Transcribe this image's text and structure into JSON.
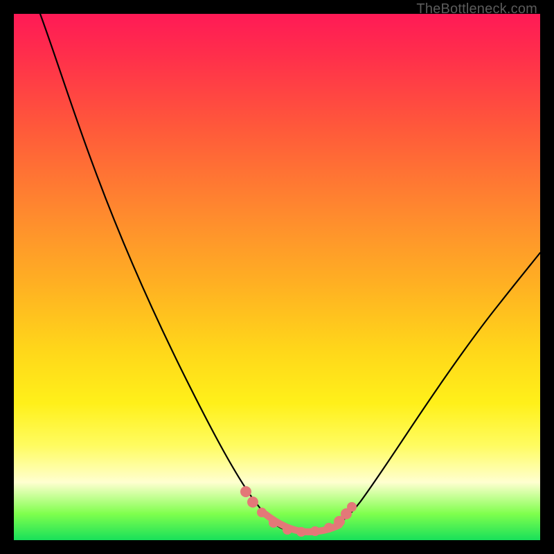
{
  "attribution": "TheBottleneck.com",
  "chart_data": {
    "type": "line",
    "title": "",
    "xlabel": "",
    "ylabel": "",
    "xlim": [
      0,
      100
    ],
    "ylim": [
      0,
      100
    ],
    "grid": false,
    "legend": false,
    "note": "V-shaped bottleneck curve over a red→yellow→green vertical gradient. Y values estimated from a 0–100 scale (0 at bottom = best / green, 100 at top = worst / red). Axes are unlabeled in the source image.",
    "series": [
      {
        "name": "bottleneck-curve",
        "x": [
          5,
          10,
          15,
          20,
          25,
          30,
          35,
          40,
          43,
          46,
          48,
          50,
          52,
          54,
          56,
          58,
          60,
          62,
          65,
          70,
          75,
          80,
          85,
          90,
          95,
          100
        ],
        "y": [
          100,
          90,
          79,
          67,
          55,
          43,
          31,
          19,
          12,
          7,
          4,
          2.5,
          2,
          2,
          2,
          2.5,
          3.5,
          5,
          8,
          14,
          21,
          28,
          36,
          43,
          50,
          56
        ]
      }
    ],
    "markers": {
      "name": "highlight-points",
      "color": "#e37878",
      "x": [
        43,
        46,
        48,
        50,
        52,
        54,
        56,
        58,
        60,
        62
      ],
      "y": [
        12,
        7,
        4,
        2.5,
        2,
        2,
        2,
        2.5,
        3.5,
        5
      ]
    },
    "gradient_stops": [
      {
        "pos": 0,
        "color": "#ff1a56"
      },
      {
        "pos": 22,
        "color": "#ff5a3a"
      },
      {
        "pos": 52,
        "color": "#ffb222"
      },
      {
        "pos": 74,
        "color": "#fff01a"
      },
      {
        "pos": 89,
        "color": "#ffffd0"
      },
      {
        "pos": 100,
        "color": "#18e05a"
      }
    ]
  }
}
